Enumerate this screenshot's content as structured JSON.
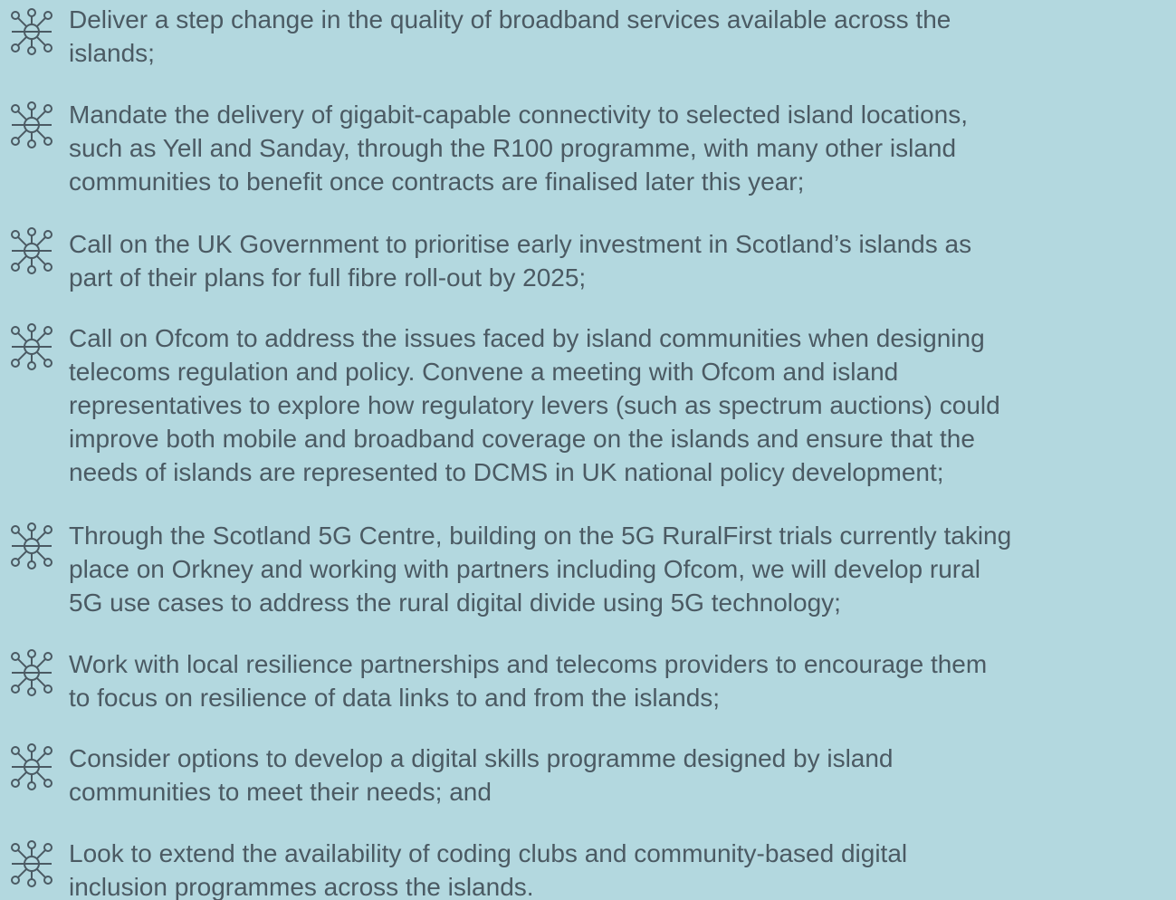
{
  "bullet_icon": "network-node-icon",
  "colors": {
    "background": "#b3d8df",
    "text": "#4b5a63",
    "icon": "#4b5a63"
  },
  "items": [
    {
      "lines": [
        "Deliver a step change in the quality of broadband services available across the",
        "islands;"
      ]
    },
    {
      "lines": [
        "Mandate the delivery of gigabit-capable connectivity to selected island locations,",
        "such as Yell and Sanday, through the R100 programme, with many other island",
        "communities to benefit once contracts are finalised later this year;"
      ]
    },
    {
      "lines": [
        "Call on the UK Government to prioritise early investment in Scotland’s islands as",
        "part of their plans for full fibre roll-out by 2025;"
      ]
    },
    {
      "lines": [
        "Call on Ofcom to address the issues faced by island communities when designing",
        "telecoms regulation and policy. Convene a meeting with Ofcom and island",
        "representatives to explore how regulatory levers (such as spectrum auctions) could",
        "improve both mobile and broadband coverage on the islands and ensure that the",
        "needs of islands are represented to DCMS in UK national policy development;"
      ]
    },
    {
      "lines": [
        "Through the Scotland 5G Centre, building on the 5G RuralFirst trials currently taking",
        "place on Orkney and working with partners including Ofcom, we will develop rural",
        "5G use cases to address the rural digital divide using 5G technology;"
      ]
    },
    {
      "lines": [
        "Work with local resilience partnerships and telecoms providers to encourage them",
        "to focus on resilience of data links to and from the islands;"
      ]
    },
    {
      "lines": [
        "Consider options to develop a digital skills programme designed by island",
        "communities to meet their needs; and"
      ]
    },
    {
      "lines": [
        "Look to extend the availability of coding clubs and community-based digital",
        "inclusion programmes across the islands."
      ]
    }
  ]
}
